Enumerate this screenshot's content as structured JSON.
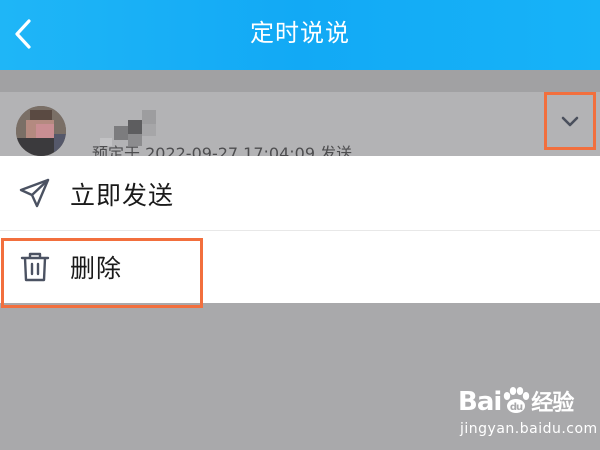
{
  "header": {
    "title": "定时说说",
    "back_icon": "chevron-left-icon",
    "color": "#17b0f6"
  },
  "post": {
    "scheduled_text": "预定于 2022-09-27 17:04:09 发送",
    "toggle_icon": "chevron-down-icon"
  },
  "menu": {
    "items": [
      {
        "label": "立即发送",
        "icon": "paper-plane-icon"
      },
      {
        "label": "删除",
        "icon": "trash-icon"
      }
    ]
  },
  "highlight_color": "#f26f3d",
  "watermark": {
    "logo": "Bai",
    "logo_cn": "经验",
    "url": "jingyan.baidu.com"
  }
}
